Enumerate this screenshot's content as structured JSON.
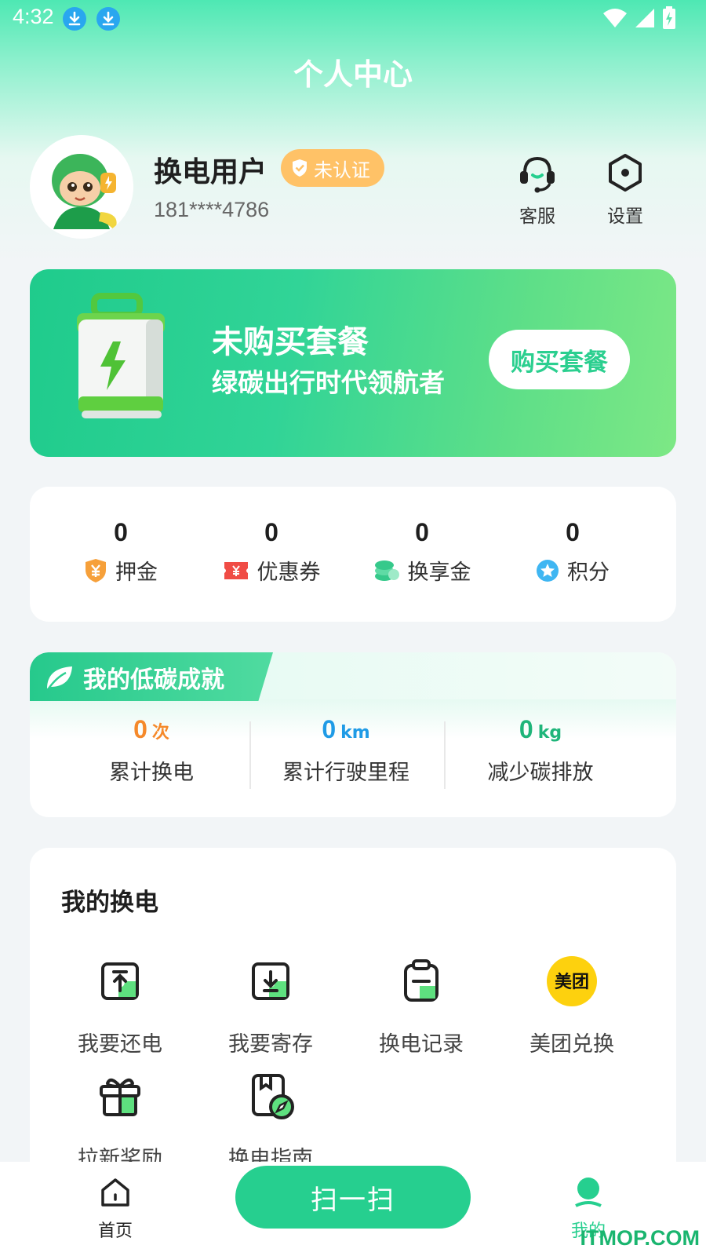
{
  "status_bar": {
    "time": "4:32"
  },
  "header": {
    "title": "个人中心"
  },
  "profile": {
    "name": "换电用户",
    "badge": "未认证",
    "phone": "181****4786",
    "actions": [
      {
        "label": "客服",
        "icon": "headset-icon"
      },
      {
        "label": "设置",
        "icon": "settings-hexagon-icon"
      }
    ]
  },
  "plan": {
    "title": "未购买套餐",
    "subtitle": "绿碳出行时代领航者",
    "button": "购买套餐"
  },
  "wallet": [
    {
      "value": "0",
      "label": "押金",
      "icon": "deposit-shield-icon"
    },
    {
      "value": "0",
      "label": "优惠券",
      "icon": "coupon-icon"
    },
    {
      "value": "0",
      "label": "换享金",
      "icon": "coins-icon"
    },
    {
      "value": "0",
      "label": "积分",
      "icon": "points-star-icon"
    }
  ],
  "carbon": {
    "title": "我的低碳成就",
    "stats": [
      {
        "value": "0",
        "unit": "次",
        "label": "累计换电",
        "color": "#f5892a"
      },
      {
        "value": "0",
        "unit": "km",
        "label": "累计行驶里程",
        "color": "#1f9be6"
      },
      {
        "value": "0",
        "unit": "kg",
        "label": "减少碳排放",
        "color": "#1fb57a"
      }
    ]
  },
  "swap": {
    "title": "我的换电",
    "items": [
      {
        "label": "我要还电",
        "icon": "return-battery-icon"
      },
      {
        "label": "我要寄存",
        "icon": "deposit-storage-icon"
      },
      {
        "label": "换电记录",
        "icon": "swap-record-icon"
      },
      {
        "label": "美团兑换",
        "icon": "meituan-icon",
        "icon_text": "美团"
      },
      {
        "label": "拉新奖励",
        "icon": "gift-icon"
      },
      {
        "label": "换电指南",
        "icon": "guide-compass-icon"
      }
    ]
  },
  "bottom_nav": {
    "home": "首页",
    "scan": "扫一扫",
    "mine": "我的",
    "watermark": "ITMOP.COM"
  },
  "colors": {
    "accent": "#26cf8f",
    "badge": "#ffc267"
  }
}
